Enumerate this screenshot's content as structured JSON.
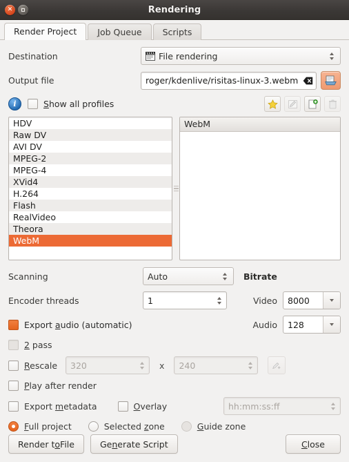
{
  "window": {
    "title": "Rendering",
    "close_icon": "close-icon",
    "maximize_icon": "maximize-icon"
  },
  "tabs": [
    {
      "label": "Render Project",
      "active": true
    },
    {
      "label": "Job Queue",
      "active": false
    },
    {
      "label": "Scripts",
      "active": false
    }
  ],
  "destination": {
    "label": "Destination",
    "value": "File rendering",
    "icon": "film-clapper-icon"
  },
  "output_file": {
    "label": "Output file",
    "value": "roger/kdenlive/risitas-linux-3.webm",
    "clear_icon": "clear-text-icon",
    "open_icon": "open-folder-icon"
  },
  "profiles_bar": {
    "info_icon": "info-icon",
    "info_glyph": "i",
    "show_all_label": "Show all profiles",
    "show_all_checked": false,
    "tools": [
      {
        "name": "favorite-star-icon",
        "enabled": true
      },
      {
        "name": "edit-pencil-icon",
        "enabled": false
      },
      {
        "name": "new-profile-icon",
        "enabled": true
      },
      {
        "name": "delete-trash-icon",
        "enabled": false
      }
    ]
  },
  "profile_list": {
    "items": [
      "HDV",
      "Raw DV",
      "AVI DV",
      "MPEG-2",
      "MPEG-4",
      "XVid4",
      "H.264",
      "Flash",
      "RealVideo",
      "Theora",
      "WebM"
    ],
    "selected": "WebM"
  },
  "profile_details": {
    "header": "WebM",
    "body": ""
  },
  "scanning": {
    "label": "Scanning",
    "value": "Auto"
  },
  "encoder_threads": {
    "label": "Encoder threads",
    "value": "1"
  },
  "bitrate": {
    "title": "Bitrate",
    "video_label": "Video",
    "video_value": "8000",
    "audio_label": "Audio",
    "audio_value": "128"
  },
  "options": {
    "export_audio": {
      "label": "Export audio (automatic)",
      "checked": true,
      "enabled": true
    },
    "two_pass": {
      "label": "2 pass",
      "checked": false,
      "enabled": false
    },
    "rescale": {
      "label": "Rescale",
      "checked": false,
      "width": "320",
      "x_sep": "x",
      "height": "240",
      "edit_icon": "rescale-edit-icon"
    },
    "play_after_render": {
      "label": "Play after render",
      "checked": false
    },
    "export_metadata": {
      "label": "Export metadata",
      "checked": false
    },
    "overlay": {
      "label": "Overlay",
      "checked": false,
      "timecode_placeholder": "hh:mm:ss:ff"
    }
  },
  "zone": {
    "full_project": {
      "label": "Full project",
      "selected": true,
      "enabled": true
    },
    "selected_zone": {
      "label": "Selected zone",
      "selected": false,
      "enabled": true
    },
    "guide_zone": {
      "label": "Guide zone",
      "selected": false,
      "enabled": false
    }
  },
  "actions": {
    "render": "Render to File",
    "generate": "Generate Script",
    "close": "Close"
  },
  "colors": {
    "accent": "#ec6a35",
    "titlebar": "#3b3836",
    "window_bg": "#f2f1f0"
  }
}
